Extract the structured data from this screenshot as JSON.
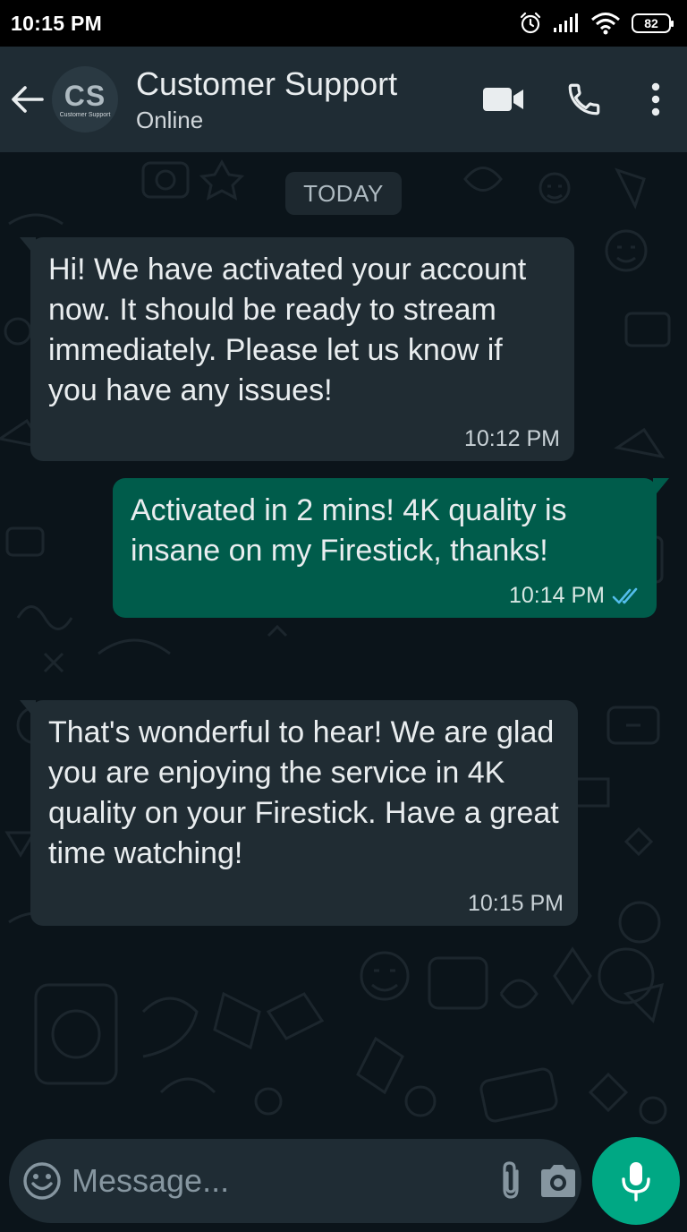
{
  "status_bar": {
    "time": "10:15 PM",
    "battery": "82"
  },
  "header": {
    "avatar_initials": "CS",
    "avatar_subtitle": "Customer Support",
    "contact_name": "Customer Support",
    "contact_status": "Online"
  },
  "chat": {
    "date_chip": "TODAY",
    "messages": [
      {
        "direction": "incoming",
        "text": "Hi! We have activated your account now. It should be ready to stream immediately. Please let us know if you have any issues!",
        "time": "10:12 PM"
      },
      {
        "direction": "outgoing",
        "text": "Activated in 2 mins! 4K quality is insane on my Firestick, thanks!",
        "time": "10:14 PM",
        "status": "read"
      },
      {
        "direction": "incoming",
        "text": "That's wonderful to hear! We are glad you are enjoying the service in 4K quality on your Firestick. Have a great time watching!",
        "time": "10:15 PM"
      }
    ]
  },
  "composer": {
    "placeholder": "Message..."
  },
  "colors": {
    "header": "#1f2c34",
    "chat_bg": "#0b141a",
    "incoming_bubble": "#202c33",
    "outgoing_bubble": "#005c4b",
    "accent": "#00a884",
    "read_tick": "#53bdeb"
  },
  "icons": [
    "back-arrow-icon",
    "video-call-icon",
    "phone-icon",
    "more-options-icon",
    "emoji-icon",
    "attach-icon",
    "camera-icon",
    "mic-icon",
    "read-receipt-icon"
  ]
}
